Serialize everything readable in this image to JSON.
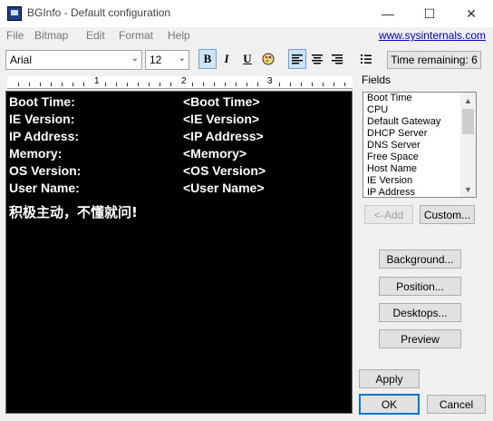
{
  "window": {
    "title": "BGInfo - Default configuration",
    "minimize_glyph": "—",
    "maximize_glyph": "☐",
    "close_glyph": "✕"
  },
  "menu": {
    "items": [
      "File",
      "Bitmap",
      "Edit",
      "Format",
      "Help"
    ],
    "link": "www.sysinternals.com"
  },
  "toolbar": {
    "font_name": "Arial",
    "font_size": "12",
    "bold": "B",
    "italic": "I",
    "underline": "U",
    "time_remaining": "Time remaining: 6"
  },
  "ruler": {
    "numbers": [
      "1",
      "2",
      "3"
    ]
  },
  "editor": {
    "rows": [
      {
        "label": "Boot Time:",
        "value": "<Boot Time>"
      },
      {
        "label": "IE Version:",
        "value": "<IE Version>"
      },
      {
        "label": "IP Address:",
        "value": "<IP Address>"
      },
      {
        "label": "Memory:",
        "value": "<Memory>"
      },
      {
        "label": "OS Version:",
        "value": "<OS Version>"
      },
      {
        "label": "User Name:",
        "value": "<User Name>"
      }
    ],
    "extra_line": "积极主动，不懂就问!",
    "background_color": "#000000",
    "text_color": "#ffffff"
  },
  "fields": {
    "title": "Fields",
    "items": [
      "Boot Time",
      "CPU",
      "Default Gateway",
      "DHCP Server",
      "DNS Server",
      "Free Space",
      "Host Name",
      "IE Version",
      "IP Address"
    ],
    "add_label": "<-Add",
    "custom_label": "Custom..."
  },
  "buttons": {
    "background": "Background...",
    "position": "Position...",
    "desktops": "Desktops...",
    "preview": "Preview",
    "apply": "Apply",
    "ok": "OK",
    "cancel": "Cancel"
  },
  "colors": {
    "accent": "#0078d7",
    "link": "#0000cc"
  }
}
